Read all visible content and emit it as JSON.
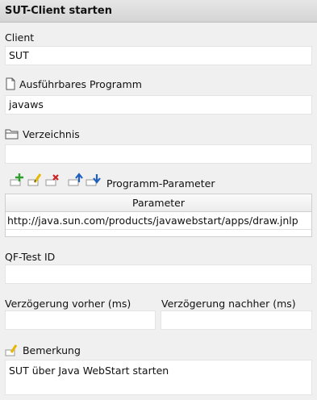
{
  "header": {
    "title": "SUT-Client starten"
  },
  "client": {
    "label": "Client",
    "value": "SUT"
  },
  "program": {
    "label": "Ausführbares Programm",
    "value": "javaws",
    "icon": "document-icon"
  },
  "directory": {
    "label": "Verzeichnis",
    "value": "",
    "icon": "folder-icon"
  },
  "parameters": {
    "label": "Programm-Parameter",
    "toolbar": [
      "add-icon",
      "edit-icon",
      "delete-icon",
      "move-up-icon",
      "move-down-icon"
    ],
    "column": "Parameter",
    "rows": [
      "http://java.sun.com/products/javawebstart/apps/draw.jnlp"
    ]
  },
  "qftest_id": {
    "label": "QF-Test ID",
    "value": ""
  },
  "delay_before": {
    "label": "Verzögerung vorher (ms)",
    "value": ""
  },
  "delay_after": {
    "label": "Verzögerung nachher (ms)",
    "value": ""
  },
  "comment": {
    "label": "Bemerkung",
    "value": "SUT über Java WebStart starten"
  },
  "colors": {
    "add": "#2e9e2e",
    "edit": "#e6b800",
    "delete": "#cc2222",
    "arrow": "#1f5fbf"
  }
}
